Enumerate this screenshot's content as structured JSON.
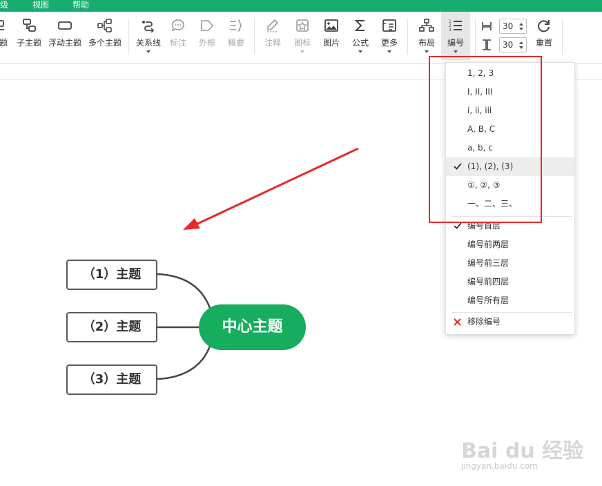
{
  "menu": {
    "items": [
      "级",
      "视图",
      "帮助"
    ]
  },
  "toolbar": {
    "tools": [
      {
        "label": "题",
        "icon": "topic-icon"
      },
      {
        "label": "子主题",
        "icon": "subtopic-icon"
      },
      {
        "label": "浮动主题",
        "icon": "floating-topic-icon"
      },
      {
        "label": "多个主题",
        "icon": "multiple-topics-icon"
      },
      {
        "label": "关系线",
        "icon": "relationship-icon"
      },
      {
        "label": "标注",
        "icon": "callout-icon"
      },
      {
        "label": "外框",
        "icon": "boundary-icon"
      },
      {
        "label": "概要",
        "icon": "summary-icon"
      },
      {
        "label": "注释",
        "icon": "note-icon"
      },
      {
        "label": "图标",
        "icon": "marker-icon"
      },
      {
        "label": "图片",
        "icon": "image-icon"
      },
      {
        "label": "公式",
        "icon": "formula-icon"
      },
      {
        "label": "更多",
        "icon": "more-icon"
      },
      {
        "label": "布局",
        "icon": "layout-icon"
      },
      {
        "label": "编号",
        "icon": "numbering-icon"
      }
    ],
    "spacing_h": "30",
    "spacing_v": "30",
    "reset_label": "重置"
  },
  "numbering_menu": {
    "formats": [
      "1, 2, 3",
      "I, II, III",
      "i, ii, iii",
      "A, B, C",
      "a, b, c",
      "(1), (2), (3)",
      "①, ②, ③",
      "一、二、三、"
    ],
    "selected_format": "(1), (2), (3)",
    "levels": [
      "编号首层",
      "编号前两层",
      "编号前三层",
      "编号前四层",
      "编号所有层"
    ],
    "selected_level": "编号首层",
    "remove_label": "移除编号"
  },
  "mindmap": {
    "center": "中心主题",
    "topics": [
      "（1）主题",
      "（2）主题",
      "（3）主题"
    ]
  },
  "watermark": {
    "brand": "Bai du 经验",
    "url": "jingyan.baidu.com"
  },
  "colors": {
    "brand_green": "#17ad6e",
    "center_topic": "#17ad5e",
    "annotation_red": "#e8292a"
  }
}
